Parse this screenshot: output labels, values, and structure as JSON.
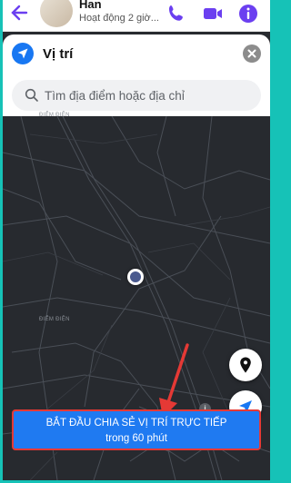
{
  "chat": {
    "contact_name": "Han",
    "status": "Hoạt động 2 giờ..."
  },
  "icons": {
    "back": "back-arrow-icon",
    "call": "phone-icon",
    "video": "video-call-icon",
    "info": "info-icon",
    "location": "location-arrow-icon",
    "close": "close-icon",
    "search": "search-icon",
    "pin": "map-pin-icon",
    "recenter": "navigation-icon"
  },
  "location_sheet": {
    "title": "Vị trí",
    "search_placeholder": "Tìm địa điểm hoặc địa chỉ"
  },
  "map": {
    "labels": [
      "ĐIỂM ĐIỆN",
      "ĐIỂM ĐIỆN"
    ]
  },
  "start_sharing": {
    "line1": "BẮT ĐẦU CHIA SẺ VỊ TRÍ TRỰC TIẾP",
    "line2": "trong 60 phút"
  },
  "colors": {
    "accent": "#6b3ff0",
    "brand_blue": "#1877f2",
    "map_bg": "#272a2f",
    "annotation_red": "#e53935",
    "border_teal": "#16c2b7"
  }
}
